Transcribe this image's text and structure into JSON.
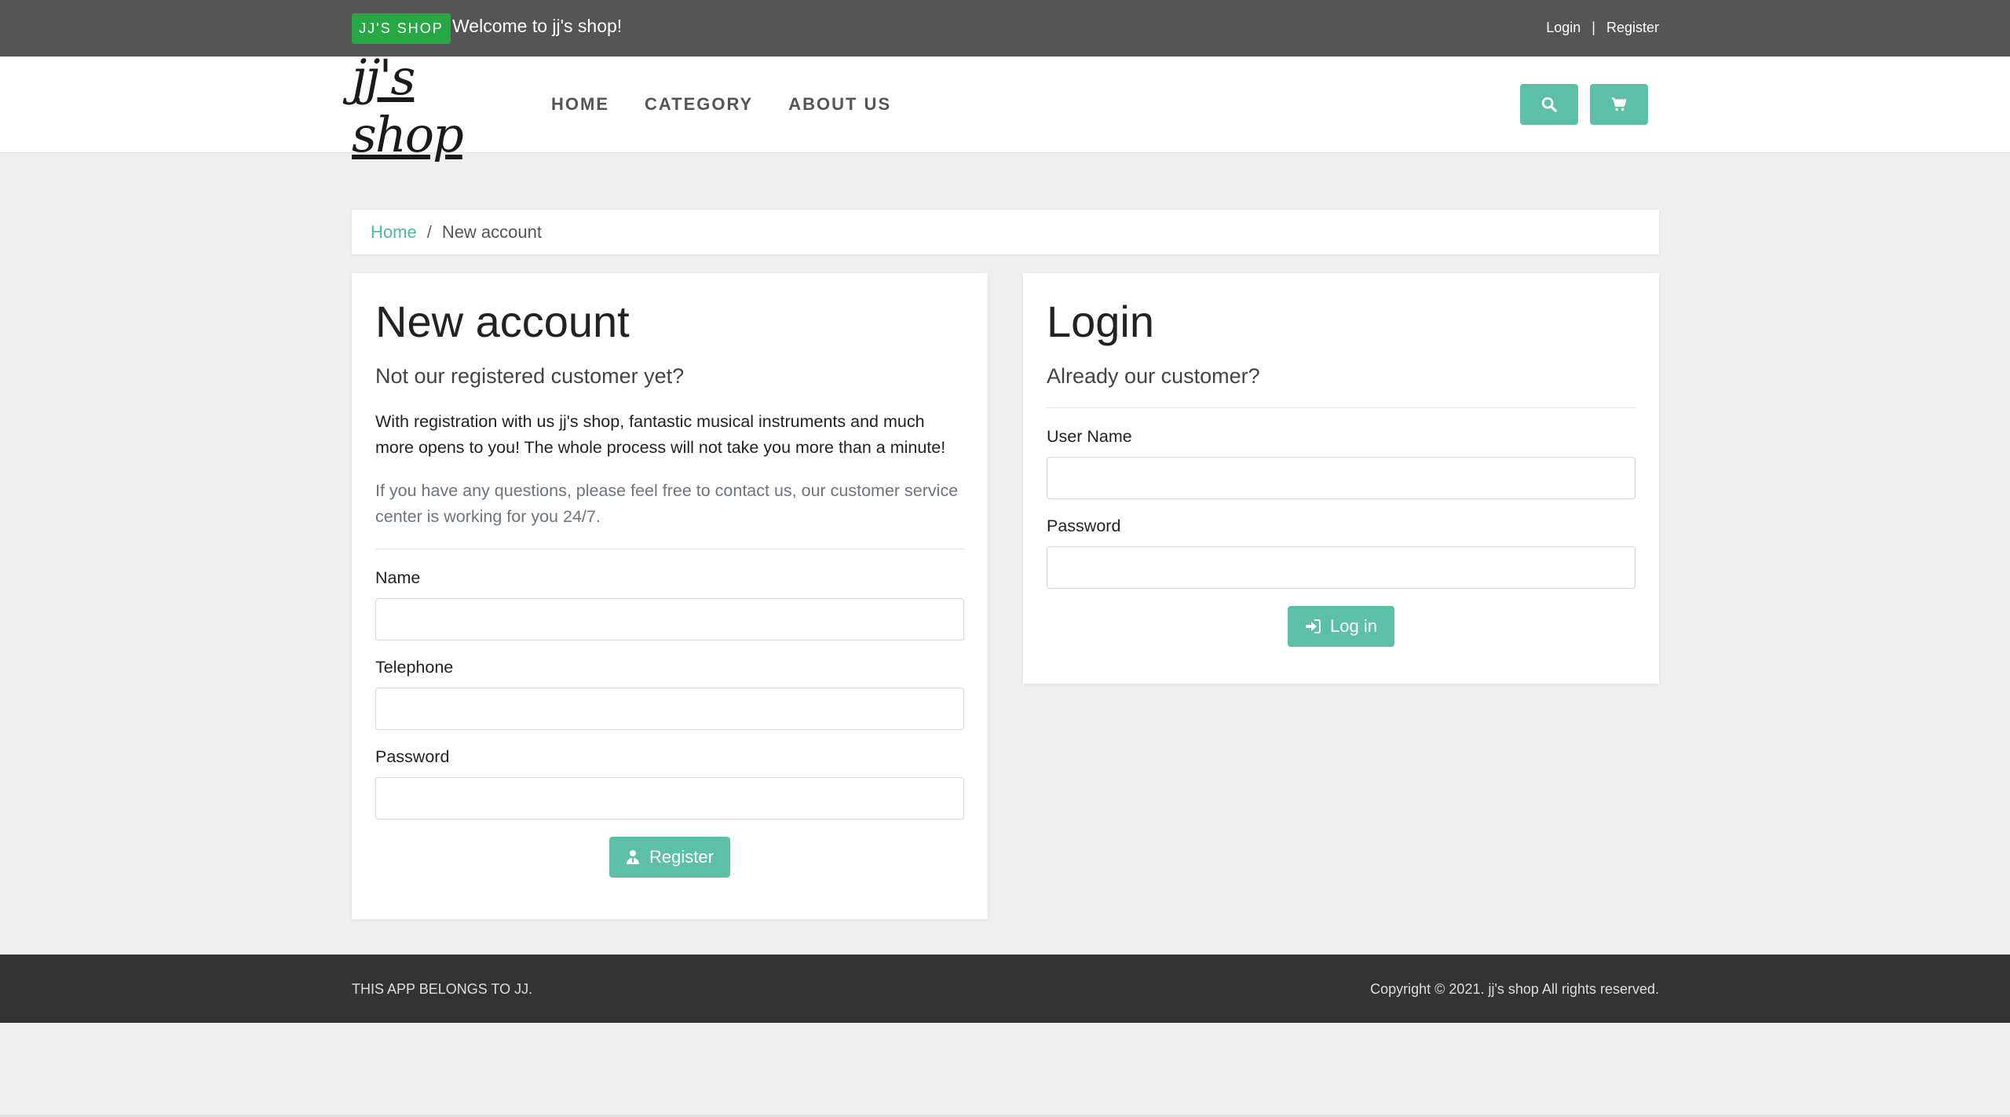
{
  "topbar": {
    "badge": "JJ'S SHOP",
    "welcome": "Welcome to jj's shop!",
    "login_link": "Login",
    "separator": "|",
    "register_link": "Register"
  },
  "navbar": {
    "logo_text": "jj's shop",
    "links": [
      "HOME",
      "CATEGORY",
      "ABOUT US"
    ],
    "search_icon": "search-icon",
    "cart_icon": "cart-icon"
  },
  "breadcrumb": {
    "home": "Home",
    "separator": "/",
    "current": "New account"
  },
  "register": {
    "title": "New account",
    "lead": "Not our registered customer yet?",
    "description": "With registration with us jj's shop, fantastic musical instruments and much more opens to you! The whole process will not take you more than a minute!",
    "note": "If you have any questions, please feel free to contact us, our customer service center is working for you 24/7.",
    "name_label": "Name",
    "name_value": "",
    "telephone_label": "Telephone",
    "telephone_value": "",
    "password_label": "Password",
    "password_value": "",
    "button_label": "Register",
    "button_icon": "user-icon"
  },
  "login": {
    "title": "Login",
    "lead": "Already our customer?",
    "username_label": "User Name",
    "username_value": "",
    "password_label": "Password",
    "password_value": "",
    "button_label": "Log in",
    "button_icon": "sign-in-icon"
  },
  "footer": {
    "left": "THIS APP BELONGS TO JJ.",
    "right": "Copyright © 2021. jj's shop All rights reserved."
  },
  "colors": {
    "accent": "#5bc0a5",
    "badge": "#28a745",
    "topbar": "#555555",
    "footer": "#333333"
  }
}
